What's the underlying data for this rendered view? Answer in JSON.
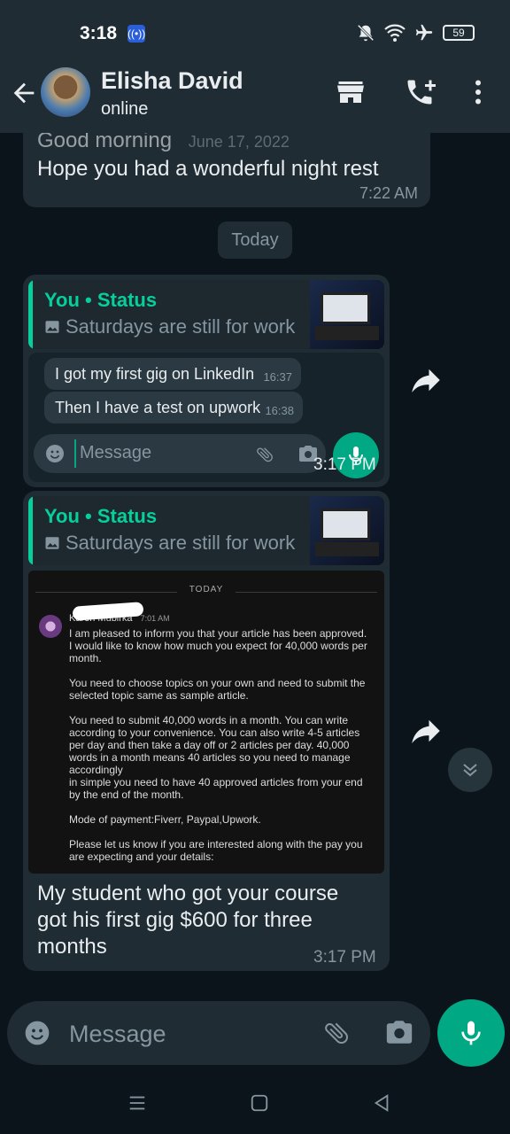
{
  "status_bar": {
    "time": "3:18",
    "battery": "59"
  },
  "header": {
    "name": "Elisha David",
    "status": "online"
  },
  "chat": {
    "prev_message": {
      "partial_text": "Good morning",
      "partial_date": "June 17, 2022",
      "text": "Hope you had a wonderful night rest",
      "time": "7:22 AM"
    },
    "date_separator": "Today",
    "message1": {
      "quote_title": "You • Status",
      "quote_sub": "Saturdays are still for work",
      "bubbles": [
        {
          "text": "I got my first gig on LinkedIn",
          "time": "16:37"
        },
        {
          "text": "Then I have a test on upwork",
          "time": "16:38"
        }
      ],
      "inner_placeholder": "Message",
      "time": "3:17 PM"
    },
    "message2": {
      "quote_title": "You • Status",
      "quote_sub": "Saturdays are still for work",
      "screenshot": {
        "today": "TODAY",
        "sender": "Karen Mubirka",
        "sender_time": "7:01 AM",
        "body": "I am pleased to inform you that your article has been approved. I would like to know how much you expect for 40,000 words per month.\n\nYou need to choose topics on your own and need to submit the selected topic same as sample article.\n\nYou need to submit 40,000 words in a month. You can write according to your convenience. You can also write 4-5 articles per day and then take a day off or 2 articles per day. 40,000 words in a month means 40 articles so you need to manage accordingly\nin simple you need to have 40 approved articles from your end by the end of the month.\n\nMode of payment:Fiverr, Paypal,Upwork.\n\nPlease let us know if you are interested along with the pay you are expecting and your details:"
      },
      "text": "My student who got your course got his first gig $600 for three months",
      "time": "3:17 PM"
    }
  },
  "input": {
    "placeholder": "Message"
  },
  "colors": {
    "accent": "#00a884",
    "quote": "#06cf9c",
    "bubble": "#1f2c34",
    "background": "#0b141a"
  }
}
